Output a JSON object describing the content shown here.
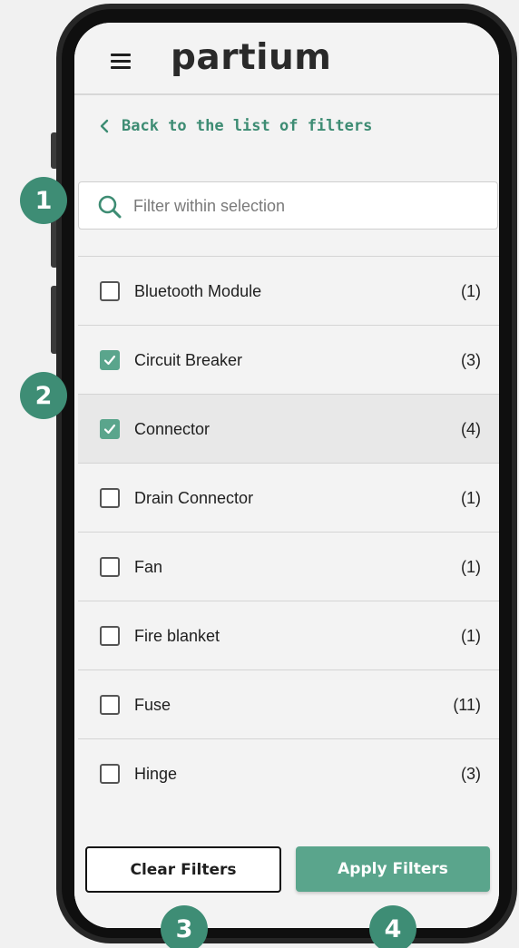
{
  "brand": {
    "logo_text": "partium",
    "accent_color": "#5aa58c",
    "badge_color": "#3e8d75"
  },
  "nav": {
    "back_label": "Back to the list of filters",
    "menu_icon": "hamburger-menu-icon",
    "back_icon": "chevron-left-icon"
  },
  "search": {
    "placeholder": "Filter within selection",
    "value": "",
    "icon": "search-icon"
  },
  "filter_items": [
    {
      "label": "Bluetooth Module",
      "count": "(1)",
      "checked": false
    },
    {
      "label": "Circuit Breaker",
      "count": "(3)",
      "checked": true
    },
    {
      "label": "Connector",
      "count": "(4)",
      "checked": true
    },
    {
      "label": "Drain Connector",
      "count": "(1)",
      "checked": false
    },
    {
      "label": "Fan",
      "count": "(1)",
      "checked": false
    },
    {
      "label": "Fire blanket",
      "count": "(1)",
      "checked": false
    },
    {
      "label": "Fuse",
      "count": "(11)",
      "checked": false
    },
    {
      "label": "Hinge",
      "count": "(3)",
      "checked": false
    }
  ],
  "actions": {
    "clear_label": "Clear Filters",
    "apply_label": "Apply Filters"
  },
  "callouts": [
    "1",
    "2",
    "3",
    "4"
  ]
}
